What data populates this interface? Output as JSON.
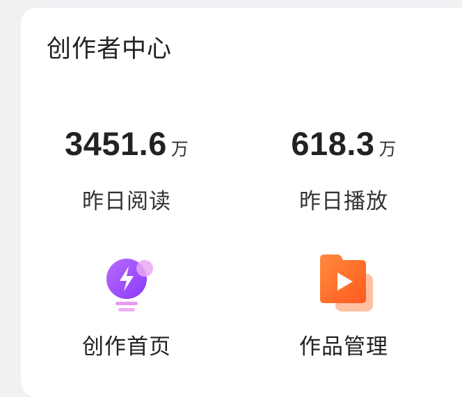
{
  "title": "创作者中心",
  "stats": [
    {
      "value": "3451.6",
      "unit": "万",
      "label": "昨日阅读"
    },
    {
      "value": "618.3",
      "unit": "万",
      "label": "昨日播放"
    }
  ],
  "entries": [
    {
      "label": "创作首页",
      "icon": "lightbulb-bolt-icon"
    },
    {
      "label": "作品管理",
      "icon": "video-folder-icon"
    }
  ],
  "colors": {
    "bulb_purple": "#9b4dfb",
    "bulb_pink": "#e69bf2",
    "folder_orange": "#ff6a2a",
    "folder_orange_light": "#ffb08a"
  }
}
